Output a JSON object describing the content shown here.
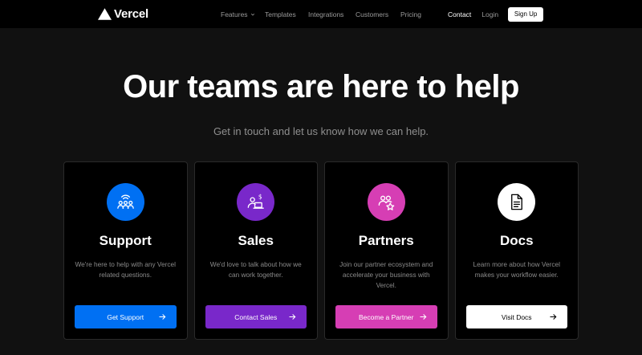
{
  "nav": {
    "brand": "Vercel",
    "links": [
      "Features",
      "Templates",
      "Integrations",
      "Customers",
      "Pricing"
    ],
    "contact": "Contact",
    "login": "Login",
    "signup": "Sign Up"
  },
  "hero": {
    "title": "Our teams are here to help",
    "subtitle": "Get in touch and let us know how we can help."
  },
  "cards": [
    {
      "title": "Support",
      "desc": "We're here to help with any Vercel related questions.",
      "button": "Get Support",
      "icon": "support-people-icon",
      "icon_bg": "#0070f3",
      "button_bg": "#0070f3",
      "button_color": "#ffffff"
    },
    {
      "title": "Sales",
      "desc": "We'd love to talk about how we can work together.",
      "button": "Contact Sales",
      "icon": "sales-laptop-icon",
      "icon_bg": "#7928ca",
      "button_bg": "#7928ca",
      "button_color": "#ffffff"
    },
    {
      "title": "Partners",
      "desc": "Join our partner ecosystem and accelerate your business with Vercel.",
      "button": "Become a Partner",
      "icon": "partners-star-icon",
      "icon_bg": "#d63eb4",
      "button_bg": "#d63eb4",
      "button_color": "#ffffff"
    },
    {
      "title": "Docs",
      "desc": "Learn more about how Vercel makes your workflow easier.",
      "button": "Visit Docs",
      "icon": "document-icon",
      "icon_bg": "#ffffff",
      "button_bg": "#ffffff",
      "button_color": "#000000"
    }
  ]
}
